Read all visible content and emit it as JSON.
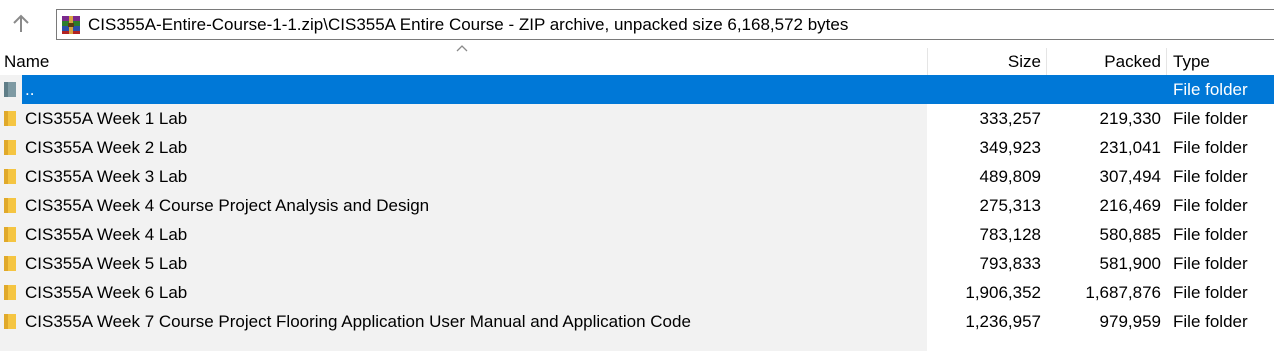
{
  "toolbar": {
    "path": "CIS355A-Entire-Course-1-1.zip\\CIS355A Entire Course - ZIP archive, unpacked size 6,168,572 bytes",
    "up_icon": "arrow-up-icon",
    "archive_icon": "winrar-archive-icon"
  },
  "columns": {
    "name": "Name",
    "size": "Size",
    "packed": "Packed",
    "type": "Type"
  },
  "rows": [
    {
      "name": "..",
      "size": "",
      "packed": "",
      "type": "File folder",
      "selected": true,
      "icon": "parent-folder-icon"
    },
    {
      "name": "CIS355A Week 1 Lab",
      "size": "333,257",
      "packed": "219,330",
      "type": "File folder",
      "icon": "folder-icon"
    },
    {
      "name": "CIS355A Week 2 Lab",
      "size": "349,923",
      "packed": "231,041",
      "type": "File folder",
      "icon": "folder-icon"
    },
    {
      "name": "CIS355A Week 3 Lab",
      "size": "489,809",
      "packed": "307,494",
      "type": "File folder",
      "icon": "folder-icon"
    },
    {
      "name": "CIS355A Week 4 Course Project Analysis and Design",
      "size": "275,313",
      "packed": "216,469",
      "type": "File folder",
      "icon": "folder-icon"
    },
    {
      "name": "CIS355A Week 4 Lab",
      "size": "783,128",
      "packed": "580,885",
      "type": "File folder",
      "icon": "folder-icon"
    },
    {
      "name": "CIS355A Week 5 Lab",
      "size": "793,833",
      "packed": "581,900",
      "type": "File folder",
      "icon": "folder-icon"
    },
    {
      "name": "CIS355A Week 6 Lab",
      "size": "1,906,352",
      "packed": "1,687,876",
      "type": "File folder",
      "icon": "folder-icon"
    },
    {
      "name": "CIS355A Week 7 Course Project Flooring Application User Manual and Application Code",
      "size": "1,236,957",
      "packed": "979,959",
      "type": "File folder",
      "icon": "folder-icon"
    }
  ],
  "colors": {
    "selection": "#0078d7",
    "folder": "#f5c542",
    "row_background": "#f2f2f2"
  }
}
